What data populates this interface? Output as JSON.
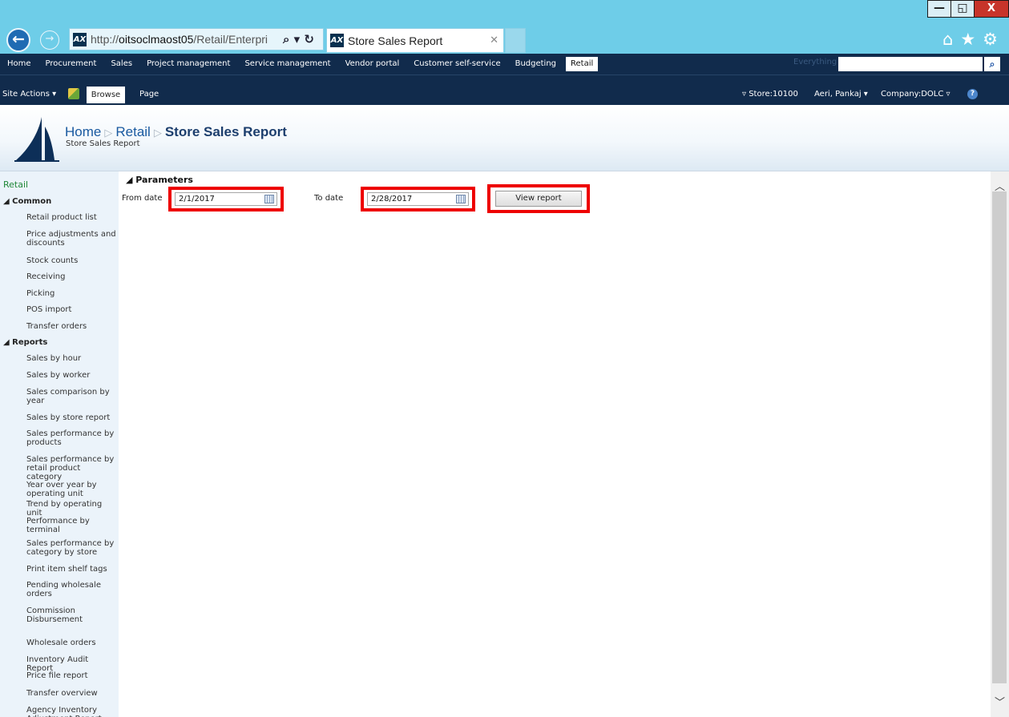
{
  "browser": {
    "url_prefix": "http://",
    "url_host": "oitsoclmaost05",
    "url_path": "/Retail/Enterpri",
    "tab_title": "Store Sales Report",
    "favicon_text": "AX",
    "window_controls": {
      "minimize": "—",
      "maximize": "◱",
      "close": "X"
    }
  },
  "topnav": {
    "items": [
      "Home",
      "Procurement",
      "Sales",
      "Project management",
      "Service management",
      "Vendor portal",
      "Customer self-service",
      "Budgeting"
    ],
    "active": "Retail",
    "search_scope": "Everything"
  },
  "ribbon": {
    "site_actions": "Site Actions ▾",
    "tab_browse": "Browse",
    "tab_page": "Page",
    "store": "▿ Store:10100",
    "user": "Aeri, Pankaj ▾",
    "company": "Company:DOLC ▿",
    "help": "?"
  },
  "title": {
    "crumb_home": "Home",
    "crumb_retail": "Retail",
    "crumb_current": "Store Sales Report",
    "subtitle": "Store Sales Report",
    "sep": "▷"
  },
  "leftnav": {
    "title": "Retail",
    "common_header": "◢ Common",
    "common_items": [
      "Retail product list",
      "Price adjustments and discounts",
      "Stock counts",
      "Receiving",
      "Picking",
      "POS import",
      "Transfer orders"
    ],
    "reports_header": "◢ Reports",
    "reports_items": [
      "Sales by hour",
      "Sales by worker",
      "Sales comparison by year",
      "Sales by store report",
      "Sales performance by products",
      "Sales performance by retail product category",
      "Year over year by operating unit",
      "Trend by operating unit",
      "Performance by terminal",
      "Sales performance by category by store",
      "Print item shelf tags",
      "Pending wholesale orders",
      "Commission Disbursement",
      "Wholesale orders",
      "Inventory Audit Report",
      "Price file report",
      "Transfer overview",
      "Agency Inventory Adjustment Report"
    ]
  },
  "parameters": {
    "header": "◢ Parameters",
    "from_label": "From date",
    "from_value": "2/1/2017",
    "to_label": "To date",
    "to_value": "2/28/2017",
    "view_button": "View report"
  },
  "colors": {
    "chrome": "#6ecde8",
    "nav_bg": "#112b4c",
    "highlight_red": "#e00000",
    "nav_green": "#218838"
  }
}
